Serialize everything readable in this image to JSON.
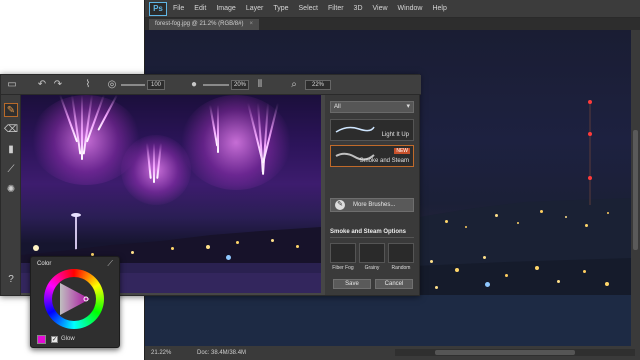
{
  "photoshop": {
    "logo": "Ps",
    "menu": [
      "File",
      "Edit",
      "Image",
      "Layer",
      "Type",
      "Select",
      "Filter",
      "3D",
      "View",
      "Window",
      "Help"
    ],
    "doc_tab": "forest-fog.jpg @ 21.2% (RGB/8#)",
    "status_zoom": "21.22%",
    "status_doc": "Doc: 38.4M/38.4M"
  },
  "app": {
    "toolbar": {
      "size_value": "100",
      "opacity_value": "20%",
      "zoom_value": "22%"
    },
    "panel": {
      "dropdown_value": "All",
      "brushes": [
        {
          "name": "Light It Up"
        },
        {
          "name": "Smoke and Steam",
          "tag": "NEW"
        }
      ],
      "more_brushes": "More Brushes...",
      "options_title": "Smoke and Steam Options",
      "presets": [
        "Fiber Fog",
        "Grainy",
        "Random"
      ],
      "save": "Save",
      "cancel": "Cancel"
    }
  },
  "color_picker": {
    "title": "Color",
    "glow_label": "Glow",
    "glow_checked": true,
    "current_color": "#e40bd6"
  },
  "colors": {
    "accent_orange": "#c06a2a",
    "firework": "#f4a6ff"
  }
}
